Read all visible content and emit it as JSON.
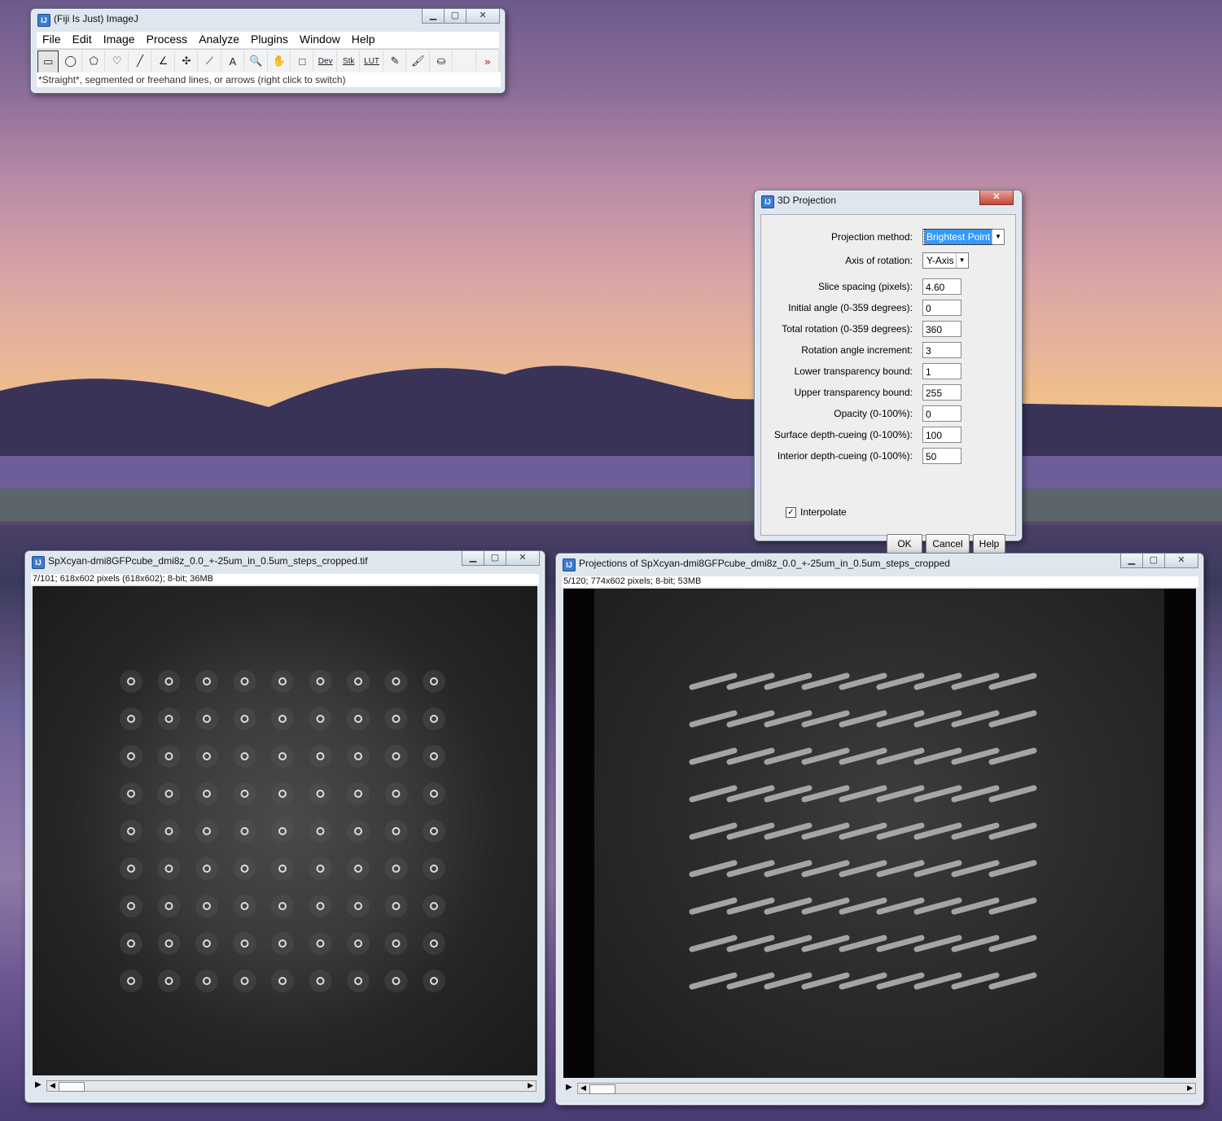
{
  "imagej": {
    "title": "(Fiji Is Just) ImageJ",
    "menu": [
      "File",
      "Edit",
      "Image",
      "Process",
      "Analyze",
      "Plugins",
      "Window",
      "Help"
    ],
    "tools": [
      {
        "name": "rectangle-tool-icon",
        "glyph": "▭"
      },
      {
        "name": "oval-tool-icon",
        "glyph": "◯"
      },
      {
        "name": "polygon-tool-icon",
        "glyph": "⬠"
      },
      {
        "name": "freehand-tool-icon",
        "glyph": "♡"
      },
      {
        "name": "line-tool-icon",
        "glyph": "╱"
      },
      {
        "name": "angle-tool-icon",
        "glyph": "∠"
      },
      {
        "name": "point-tool-icon",
        "glyph": "✣"
      },
      {
        "name": "wand-tool-icon",
        "glyph": "⟋"
      },
      {
        "name": "text-tool-icon",
        "glyph": "A"
      },
      {
        "name": "magnifier-tool-icon",
        "glyph": "🔍"
      },
      {
        "name": "hand-tool-icon",
        "glyph": "✋"
      },
      {
        "name": "color-picker-tool-icon",
        "glyph": "□"
      },
      {
        "name": "dev-menu-tool",
        "glyph": "Dev"
      },
      {
        "name": "stack-menu-tool",
        "glyph": "Stk"
      },
      {
        "name": "lut-menu-tool",
        "glyph": "LUT"
      },
      {
        "name": "pencil-tool-icon",
        "glyph": "✎"
      },
      {
        "name": "brush-tool-icon",
        "glyph": "🖌"
      },
      {
        "name": "flood-fill-tool-icon",
        "glyph": "⛀"
      },
      {
        "name": "empty-tool-slot",
        "glyph": ""
      },
      {
        "name": "more-tools-icon",
        "glyph": "»"
      }
    ],
    "status": "*Straight*, segmented or freehand lines, or arrows (right click to switch)"
  },
  "dialog": {
    "title": "3D Projection",
    "projection_method_label": "Projection method:",
    "projection_method_value": "Brightest Point",
    "axis_label": "Axis of rotation:",
    "axis_value": "Y-Axis",
    "fields": [
      {
        "label": "Slice spacing (pixels):",
        "value": "4.60"
      },
      {
        "label": "Initial angle (0-359 degrees):",
        "value": "0"
      },
      {
        "label": "Total rotation (0-359 degrees):",
        "value": "360"
      },
      {
        "label": "Rotation angle increment:",
        "value": "3"
      },
      {
        "label": "Lower transparency bound:",
        "value": "1"
      },
      {
        "label": "Upper transparency bound:",
        "value": "255"
      },
      {
        "label": "Opacity (0-100%):",
        "value": "0"
      },
      {
        "label": "Surface depth-cueing (0-100%):",
        "value": "100"
      },
      {
        "label": "Interior depth-cueing (0-100%):",
        "value": "50"
      }
    ],
    "interpolate_label": "Interpolate",
    "interpolate_checked": true,
    "ok_label": "OK",
    "cancel_label": "Cancel",
    "help_label": "Help"
  },
  "image1": {
    "title": "SpXcyan-dmi8GFPcube_dmi8z_0.0_+-25um_in_0.5um_steps_cropped.tif",
    "info": "7/101; 618x602 pixels (618x602); 8-bit; 36MB"
  },
  "image2": {
    "title": "Projections of SpXcyan-dmi8GFPcube_dmi8z_0.0_+-25um_in_0.5um_steps_cropped",
    "info": "5/120; 774x602 pixels; 8-bit; 53MB"
  },
  "colors": {
    "selection_highlight": "#3399ff",
    "close_button": "#c4463a"
  }
}
